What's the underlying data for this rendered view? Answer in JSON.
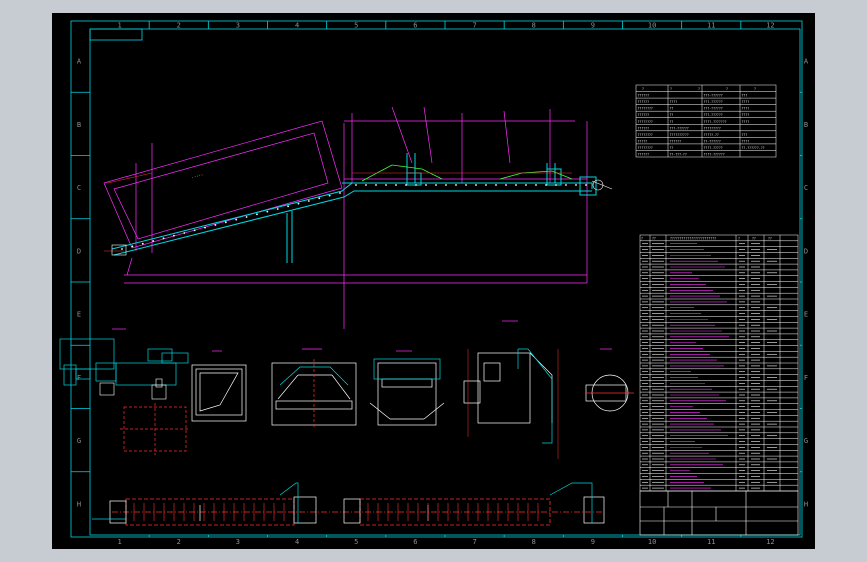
{
  "colors": {
    "background": "#000000",
    "frame": "#00d7e0",
    "section": "#ff2dff",
    "detail": "#ffffff",
    "dimension": "#ff3030",
    "highlight": "#3dff3d",
    "title_text": "#e0e0e0",
    "window_bg": "#c7ccd2"
  },
  "frame": {
    "column_labels": [
      "1",
      "2",
      "3",
      "4",
      "5",
      "6",
      "7",
      "8",
      "9",
      "10",
      "11",
      "12"
    ],
    "row_labels": [
      "A",
      "B",
      "C",
      "D",
      "E",
      "F",
      "G",
      "H"
    ]
  },
  "title_block": {
    "top_header": [
      "?",
      "?",
      "?",
      "?",
      "?"
    ],
    "top_rows": [
      [
        "??????",
        "",
        "???-??????",
        "???"
      ],
      [
        "??????",
        "????",
        "???-??????",
        "????"
      ],
      [
        "????????",
        "??",
        "???-??????",
        "????"
      ],
      [
        "??????",
        "??",
        "???-??????",
        "????"
      ],
      [
        "????????",
        "??",
        "????-???????",
        "????"
      ],
      [
        "??????",
        "???-??????",
        "?????????",
        ""
      ],
      [
        "????????",
        "??????????",
        "?????-??",
        "???"
      ],
      [
        "?????",
        "??????",
        "??-??????",
        "????"
      ],
      [
        "????????",
        "??",
        "????-?????",
        "??-??????-??"
      ],
      [
        "??????",
        "??-???-??",
        "????-??????",
        ""
      ]
    ],
    "parts_header": [
      "?",
      "??",
      "????????????????????????",
      "?",
      "??",
      "??"
    ]
  },
  "status": {
    "view": "model"
  }
}
